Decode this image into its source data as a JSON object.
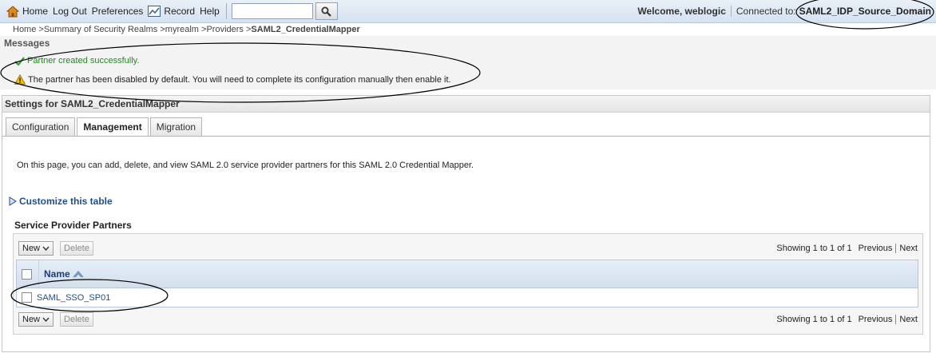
{
  "topbar": {
    "nav": [
      {
        "label": "Home",
        "icon": "home-icon"
      },
      {
        "label": "Log Out"
      },
      {
        "label": "Preferences"
      },
      {
        "label": "Record",
        "icon": "record-icon"
      },
      {
        "label": "Help"
      }
    ],
    "search_value": "",
    "welcome": "Welcome, weblogic",
    "connected_label": "Connected to:",
    "domain": "SAML2_IDP_Source_Domain"
  },
  "breadcrumb": {
    "items": [
      "Home",
      "Summary of Security Realms",
      "myrealm",
      "Providers"
    ],
    "separator": ">",
    "current": "SAML2_CredentialMapper"
  },
  "messages": {
    "title": "Messages",
    "success": "Partner created successfully.",
    "warning": "The partner has been disabled by default. You will need to complete its configuration manually then enable it."
  },
  "settings": {
    "title": "Settings for SAML2_CredentialMapper",
    "tabs": [
      {
        "label": "Configuration",
        "active": false
      },
      {
        "label": "Management",
        "active": true
      },
      {
        "label": "Migration",
        "active": false
      }
    ],
    "intro": "On this page, you can add, delete, and view SAML 2.0 service provider partners for this SAML 2.0 Credential Mapper.",
    "customize": "Customize this table",
    "section_title": "Service Provider Partners",
    "toolbar": {
      "new_label": "New",
      "delete_label": "Delete"
    },
    "pager": {
      "showing": "Showing 1 to 1 of 1",
      "previous": "Previous",
      "next": "Next"
    },
    "table": {
      "column": "Name",
      "rows": [
        "SAML_SSO_SP01"
      ]
    }
  },
  "colors": {
    "accent_link": "#1f4f8a",
    "success_text": "#238a23",
    "warning_icon": "#f2c000",
    "header_bg": "#d6e2f0"
  }
}
